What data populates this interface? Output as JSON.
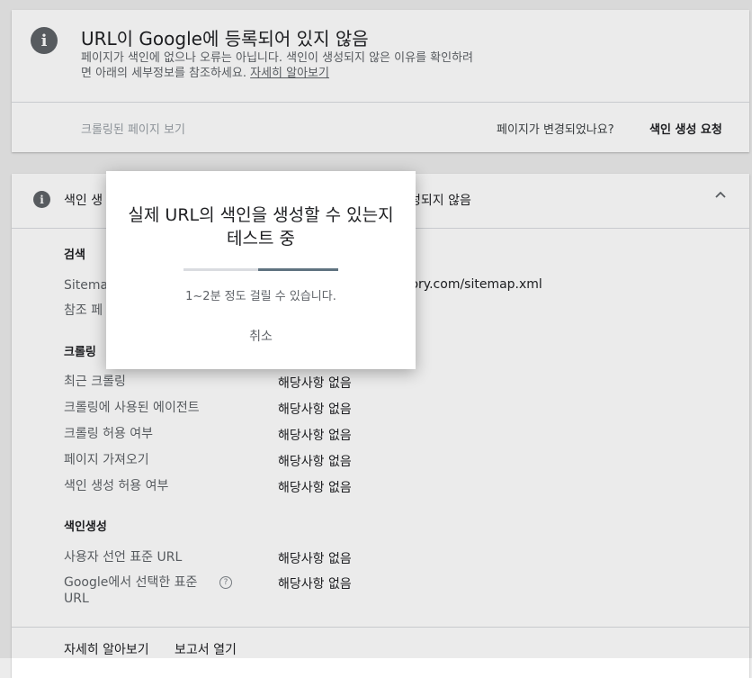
{
  "status_card": {
    "icon": "info-icon",
    "title": "URL이 Google에 등록되어 있지 않음",
    "desc_line1": "페이지가 색인에 없으나 오류는 아닙니다. 색인이 생성되지 않은 이유를 확인하려",
    "desc_line2": "면 아래의 세부정보를 참조하세요.",
    "learn_more": "자세히 알아보기",
    "view_crawled_page": "크롤링된 페이지 보기",
    "page_changed_question": "페이지가 변경되었나요?",
    "request_indexing": "색인 생성 요청"
  },
  "coverage_card": {
    "icon": "info-icon",
    "header_left": "색인 생",
    "header_right": "성되지 않음",
    "collapse_icon": "chevron-up-icon",
    "discovery": {
      "title": "검색",
      "sitemap_label": "Sitema",
      "sitemap_value": "tory.com/sitemap.xml",
      "referring_label": "참조 페"
    },
    "crawl": {
      "title": "크롤링",
      "rows": [
        {
          "label": "최근 크롤링",
          "value": "해당사항 없음"
        },
        {
          "label": "크롤링에 사용된 에이전트",
          "value": "해당사항 없음"
        },
        {
          "label": "크롤링 허용 여부",
          "value": "해당사항 없음"
        },
        {
          "label": "페이지 가져오기",
          "value": "해당사항 없음"
        },
        {
          "label": "색인 생성 허용 여부",
          "value": "해당사항 없음"
        }
      ]
    },
    "indexing": {
      "title": "색인생성",
      "rows": [
        {
          "label": "사용자 선언 표준 URL",
          "value": "해당사항 없음"
        },
        {
          "label": "Google에서 선택한 표준 URL",
          "value": "해당사항 없음"
        }
      ],
      "help_icon": "help-icon"
    },
    "footer": {
      "learn_more": "자세히 알아보기",
      "open_report": "보고서 열기"
    }
  },
  "dialog": {
    "title": "실제 URL의 색인을 생성할 수 있는지 테스트 중",
    "progress_fraction": 0.52,
    "note": "1~2분 정도 걸릴 수 있습니다.",
    "cancel": "취소"
  }
}
